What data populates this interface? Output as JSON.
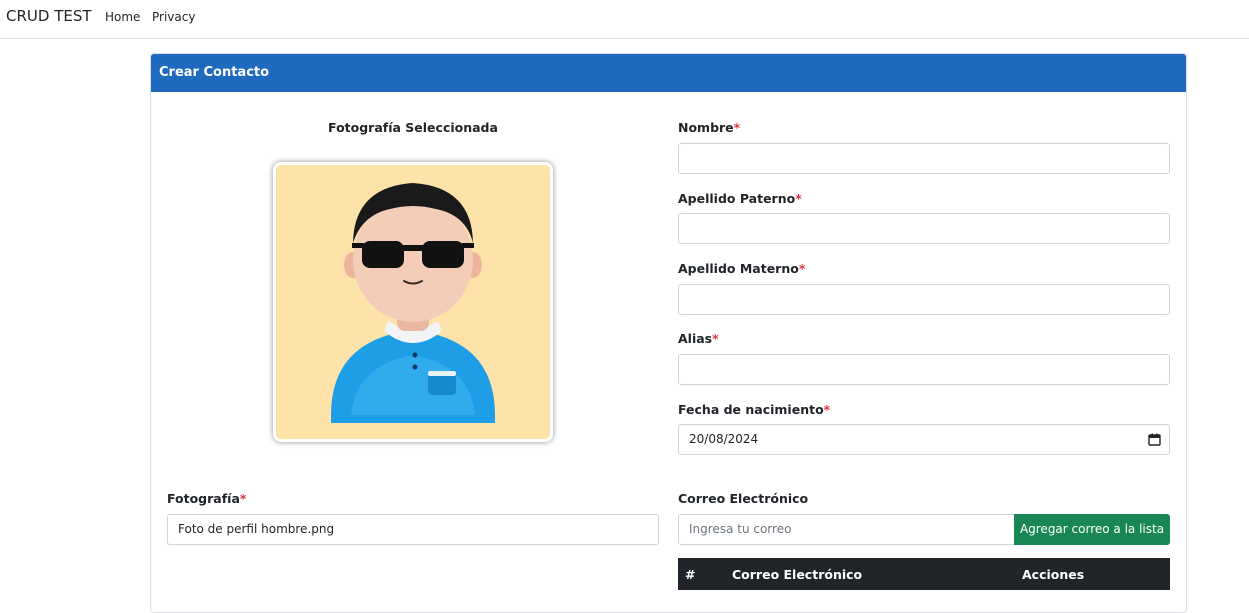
{
  "navbar": {
    "brand": "CRUD TEST",
    "links": [
      {
        "label": "Home"
      },
      {
        "label": "Privacy"
      }
    ]
  },
  "card": {
    "title": "Crear Contacto"
  },
  "photo": {
    "title": "Fotografía Seleccionada",
    "label": "Fotografía",
    "file_value": "Foto de perfil hombre.png"
  },
  "form": {
    "required_mark": "*",
    "nombre_label": "Nombre",
    "nombre_value": "",
    "apellido_paterno_label": "Apellido Paterno",
    "apellido_paterno_value": "",
    "apellido_materno_label": "Apellido Materno",
    "apellido_materno_value": "",
    "alias_label": "Alias",
    "alias_value": "",
    "fecha_label": "Fecha de nacimiento",
    "fecha_value": "20/08/2024"
  },
  "email": {
    "label": "Correo Electrónico",
    "placeholder": "Ingresa tu correo",
    "add_button": "Agregar correo a la lista",
    "table_headers": [
      "#",
      "Correo Electrónico",
      "Acciones"
    ]
  },
  "colors": {
    "header_blue": "#1f6abf",
    "button_green": "#198754",
    "required_red": "#dc3545",
    "table_header_dark": "#212529",
    "photo_background": "#fde3a9"
  }
}
